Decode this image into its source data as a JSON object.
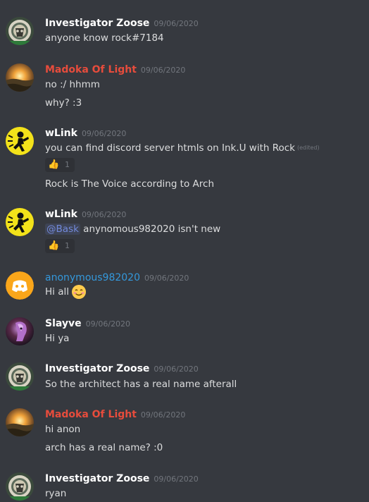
{
  "colors": {
    "background": "#36393f",
    "text": "#dcddde",
    "timestamp": "#72767d",
    "name_default": "#ffffff",
    "name_red": "#e74c3c",
    "name_blue": "#3498db",
    "mention": "#7289da",
    "reaction_bg": "#2f3136"
  },
  "messages": [
    {
      "username": "Investigator Zoose",
      "name_color": "#ffffff",
      "timestamp": "09/06/2020",
      "avatar_icon": "zoose-avatar",
      "lines": [
        "anyone know rock#7184"
      ]
    },
    {
      "username": "Madoka Of Light",
      "name_color": "#e74c3c",
      "timestamp": "09/06/2020",
      "avatar_icon": "madoka-avatar",
      "lines": [
        "no :/ hhmm",
        "why? :3"
      ]
    },
    {
      "username": "wLink",
      "name_color": "#ffffff",
      "timestamp": "09/06/2020",
      "avatar_icon": "wlink-avatar",
      "lines": [
        "you can find discord server htmls on Ink.U with Rock",
        "Rock is The Voice according to Arch"
      ],
      "edited_label": "(edited)",
      "reaction": {
        "emoji": "👍",
        "count": "1"
      }
    },
    {
      "username": "wLink",
      "name_color": "#ffffff",
      "timestamp": "09/06/2020",
      "avatar_icon": "wlink-avatar",
      "mention": "@Bask",
      "lines": [
        " anynomous982020 isn't new"
      ],
      "reaction": {
        "emoji": "👍",
        "count": "1"
      }
    },
    {
      "username": "anonymous982020",
      "name_color": "#3498db",
      "timestamp": "09/06/2020",
      "avatar_icon": "discord-default-avatar",
      "lines": [
        "Hi all"
      ],
      "emoji_icon": "smiling-face-icon"
    },
    {
      "username": "Slayve",
      "name_color": "#ffffff",
      "timestamp": "09/06/2020",
      "avatar_icon": "slayve-avatar",
      "lines": [
        "Hi ya"
      ]
    },
    {
      "username": "Investigator Zoose",
      "name_color": "#ffffff",
      "timestamp": "09/06/2020",
      "avatar_icon": "zoose-avatar",
      "lines": [
        "So the architect has a real name afterall"
      ]
    },
    {
      "username": "Madoka Of Light",
      "name_color": "#e74c3c",
      "timestamp": "09/06/2020",
      "avatar_icon": "madoka-avatar",
      "lines": [
        "hi anon",
        "arch has a real name? :0"
      ]
    },
    {
      "username": "Investigator Zoose",
      "name_color": "#ffffff",
      "timestamp": "09/06/2020",
      "avatar_icon": "zoose-avatar",
      "lines": [
        "ryan"
      ]
    }
  ]
}
